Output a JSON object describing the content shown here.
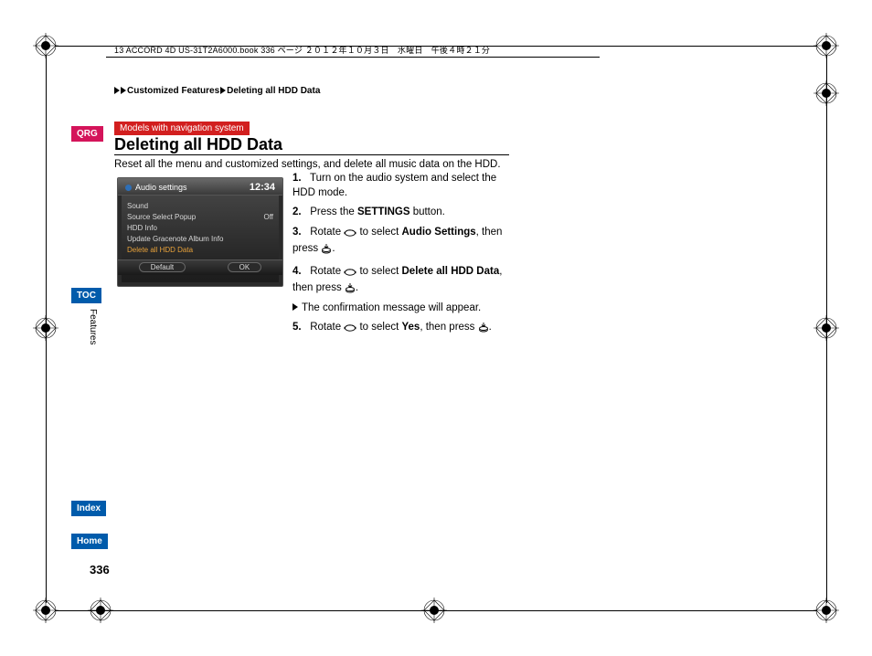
{
  "book_header": "13 ACCORD 4D US-31T2A6000.book  336 ページ  ２０１２年１０月３日　水曜日　午後４時２１分",
  "breadcrumb": {
    "level1": "Customized Features",
    "level2": "Deleting all HDD Data"
  },
  "side_tabs": {
    "qrg": "QRG",
    "toc": "TOC",
    "index": "Index",
    "home": "Home"
  },
  "vert_label": "Features",
  "badge": "Models with navigation system",
  "title": "Deleting all HDD Data",
  "intro": "Reset all the menu and customized settings, and delete all music data on the HDD.",
  "steps": {
    "s1": "Turn on the audio system and select the HDD mode.",
    "s2a": "Press the ",
    "s2b": "SETTINGS",
    "s2c": " button.",
    "s3a": "Rotate ",
    "s3b": " to select ",
    "s3c": "Audio Settings",
    "s3d": ", then press ",
    "s3e": ".",
    "s4a": "Rotate ",
    "s4b": " to select ",
    "s4c": "Delete all HDD Data",
    "s4d": ", then press ",
    "s4e": ".",
    "s4note": "The confirmation message will appear.",
    "s5a": "Rotate ",
    "s5b": " to select ",
    "s5c": "Yes",
    "s5d": ", then press ",
    "s5e": "."
  },
  "screen": {
    "title": "Audio settings",
    "clock": "12:34",
    "rows": [
      {
        "label": "Sound",
        "value": ""
      },
      {
        "label": "Source Select Popup",
        "value": "Off"
      },
      {
        "label": "HDD Info",
        "value": ""
      },
      {
        "label": "Update Gracenote Album Info",
        "value": ""
      },
      {
        "label": "Delete all HDD Data",
        "value": "",
        "hl": true
      }
    ],
    "btn_left": "Default",
    "btn_right": "OK"
  },
  "page_number": "336"
}
